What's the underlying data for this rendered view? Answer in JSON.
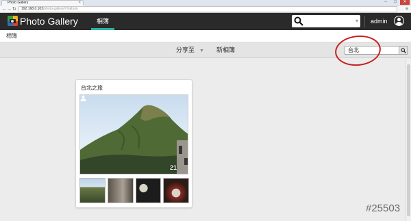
{
  "browser": {
    "tab_title": "Photo Gallery",
    "tab_close": "×",
    "url_host": "192.168.0.102",
    "url_path": "/photo-gallery/#!/album",
    "window_controls": [
      "–",
      "□",
      "✕"
    ]
  },
  "header": {
    "app_title": "Photo Gallery",
    "nav_albums": "相簿",
    "search_value": "",
    "user_name": "admin"
  },
  "breadcrumb": {
    "label": "相簿"
  },
  "toolbar": {
    "share_label": "分享至",
    "new_album_label": "新相簿",
    "filter_value": "台北"
  },
  "album": {
    "title": "台北之旅",
    "photo_count": "21"
  },
  "watermark": "#25503",
  "colors": {
    "header_bg": "#2a2a2a",
    "nav_active_underline": "#2fb3a0",
    "annotation_red": "#c8201e"
  }
}
